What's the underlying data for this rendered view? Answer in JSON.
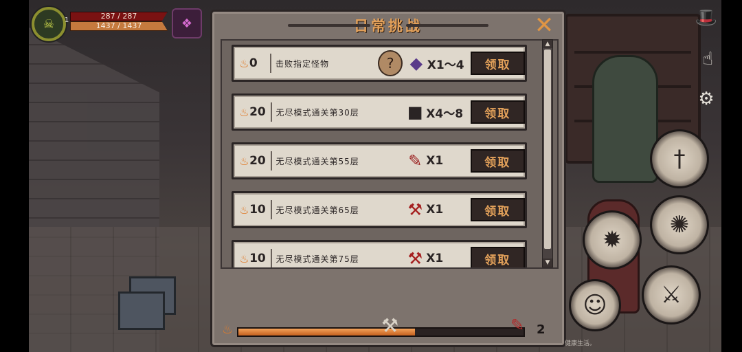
{
  "hud": {
    "level": "1",
    "hp": "287 / 287",
    "mp": "1437 / 1437",
    "portrait_icon": "green-skull-emblem",
    "pet_icon": "purple-demon-pet"
  },
  "panel": {
    "title": "日常挑战",
    "close_icon": "close-x-icon",
    "tasks": [
      {
        "points": "0",
        "desc": "击败指定怪物",
        "badge": "?",
        "item_icon": "purple-crystal",
        "qty": "X1～4",
        "claim": "领取"
      },
      {
        "points": "20",
        "desc": "无尽模式通关第30层",
        "badge": "",
        "item_icon": "dark-chest",
        "qty": "X4～8",
        "claim": "领取"
      },
      {
        "points": "20",
        "desc": "无尽模式通关第55层",
        "badge": "",
        "item_icon": "bloody-blade",
        "qty": "X1",
        "claim": "领取"
      },
      {
        "points": "10",
        "desc": "无尽模式通关第65层",
        "badge": "",
        "item_icon": "red-axe",
        "qty": "X1",
        "claim": "领取"
      },
      {
        "points": "10",
        "desc": "无尽模式通关第75层",
        "badge": "",
        "item_icon": "red-axe",
        "qty": "X1",
        "claim": "领取"
      }
    ],
    "progress": {
      "fill_fraction": 0.62,
      "count": "2"
    }
  },
  "colors": {
    "accent": "#e3a15a",
    "panel": "#7d736d",
    "row": "#dfd8cc"
  },
  "footer": "健康生活。"
}
